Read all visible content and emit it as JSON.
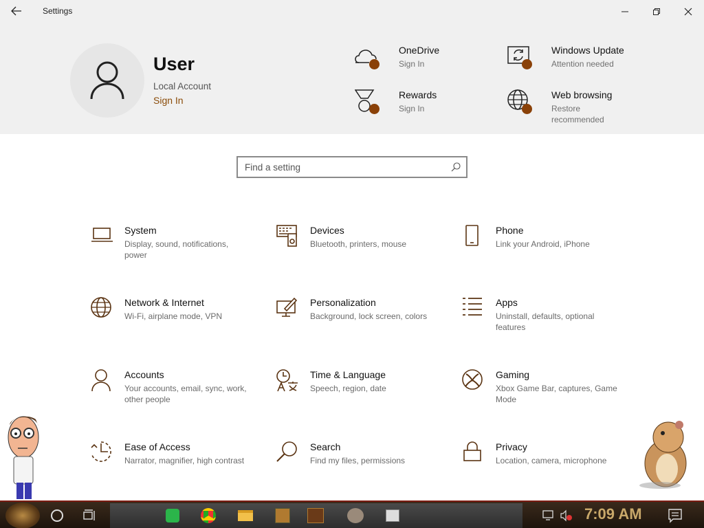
{
  "window": {
    "title": "Settings"
  },
  "user": {
    "name": "User",
    "account_type": "Local Account",
    "sign_in": "Sign In"
  },
  "header_items": [
    {
      "title": "OneDrive",
      "subtitle": "Sign In",
      "icon": "cloud-icon"
    },
    {
      "title": "Windows Update",
      "subtitle": "Attention needed",
      "icon": "sync-icon"
    },
    {
      "title": "Rewards",
      "subtitle": "Sign In",
      "icon": "medal-icon"
    },
    {
      "title": "Web browsing",
      "subtitle": "Restore recommended",
      "icon": "globe-icon"
    }
  ],
  "search": {
    "placeholder": "Find a setting"
  },
  "categories": [
    {
      "title": "System",
      "subtitle": "Display, sound, notifications, power",
      "icon": "laptop-icon"
    },
    {
      "title": "Devices",
      "subtitle": "Bluetooth, printers, mouse",
      "icon": "devices-icon"
    },
    {
      "title": "Phone",
      "subtitle": "Link your Android, iPhone",
      "icon": "phone-icon"
    },
    {
      "title": "Network & Internet",
      "subtitle": "Wi-Fi, airplane mode, VPN",
      "icon": "globe-icon"
    },
    {
      "title": "Personalization",
      "subtitle": "Background, lock screen, colors",
      "icon": "paint-icon"
    },
    {
      "title": "Apps",
      "subtitle": "Uninstall, defaults, optional features",
      "icon": "apps-list-icon"
    },
    {
      "title": "Accounts",
      "subtitle": "Your accounts, email, sync, work, other people",
      "icon": "person-icon"
    },
    {
      "title": "Time & Language",
      "subtitle": "Speech, region, date",
      "icon": "time-language-icon"
    },
    {
      "title": "Gaming",
      "subtitle": "Xbox Game Bar, captures, Game Mode",
      "icon": "xbox-icon"
    },
    {
      "title": "Ease of Access",
      "subtitle": "Narrator, magnifier, high contrast",
      "icon": "ease-of-access-icon"
    },
    {
      "title": "Search",
      "subtitle": "Find my files, permissions",
      "icon": "search-icon"
    },
    {
      "title": "Privacy",
      "subtitle": "Location, camera, microphone",
      "icon": "lock-icon"
    }
  ],
  "taskbar": {
    "clock": "7:09 AM",
    "apps": [
      "spotify-icon",
      "chrome-icon",
      "file-explorer-icon",
      "game-icon",
      "game-icon-2",
      "game-icon-3",
      "app-icon"
    ]
  },
  "colors": {
    "accent": "#8a4108",
    "header_bg": "#f0f0f0",
    "icon_stroke": "#5a3312"
  }
}
